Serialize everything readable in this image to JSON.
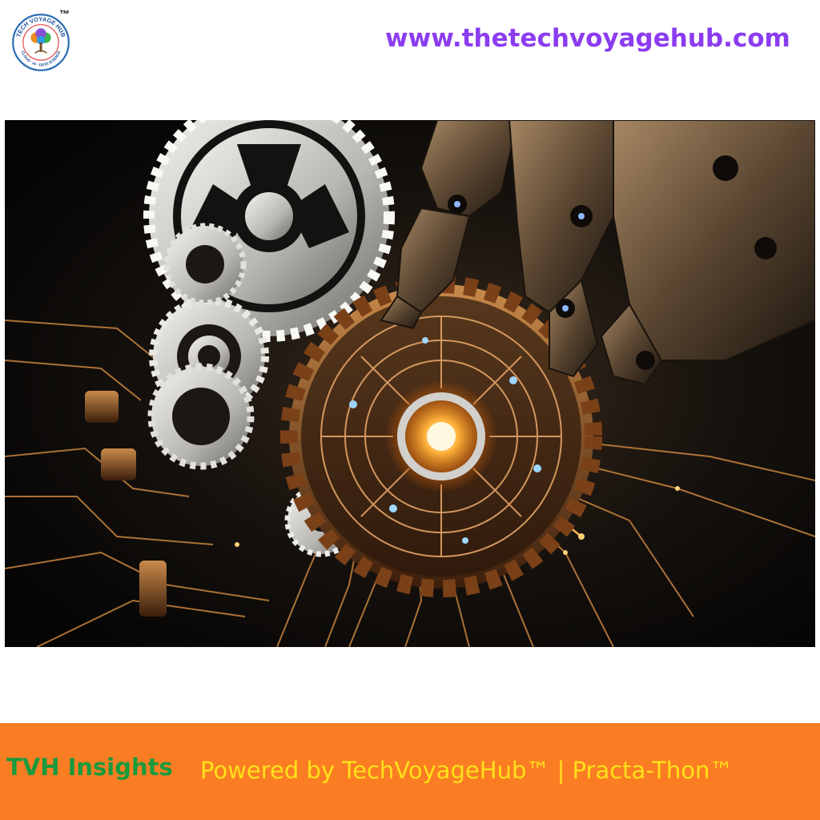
{
  "header": {
    "logo": {
      "icon": "tree-globe-logo",
      "ring_top_text": "TECH VOYAGE HUB",
      "ring_bottom_text": "CLOUD · AI · DATA SCIENCE",
      "trademark": "™"
    },
    "website": "www.thetechvoyagehub.com"
  },
  "hero": {
    "icon": "robot-hand-gears-circuit-illustration"
  },
  "footer": {
    "brand": "TVH Insights",
    "tagline": "Powered by TechVoyageHub™ | Practa-Thon™"
  },
  "colors": {
    "website": "#8b3cf0",
    "footer_bg": "#fb7d23",
    "brand": "#1a9a3c",
    "tagline": "#ffe11a"
  }
}
